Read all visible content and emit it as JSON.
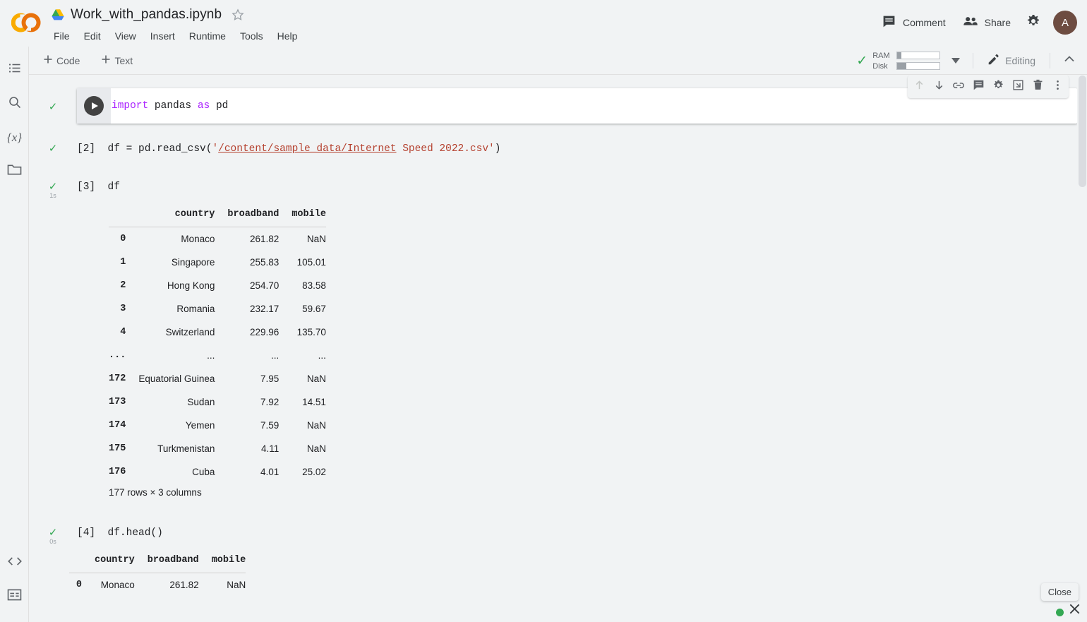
{
  "header": {
    "logo": "colab-logo",
    "drive_icon": "drive-icon",
    "doc_title": "Work_with_pandas.ipynb",
    "star_icon": "star-icon",
    "menu": [
      "File",
      "Edit",
      "View",
      "Insert",
      "Runtime",
      "Tools",
      "Help"
    ],
    "comment_label": "Comment",
    "comment_icon": "comment-icon",
    "share_label": "Share",
    "share_icon": "people-icon",
    "settings_icon": "gear-icon",
    "avatar_initial": "A",
    "avatar_color": "#6d4c41"
  },
  "toolbar": {
    "add_code": "Code",
    "add_text": "Text",
    "connected_check": "✓",
    "ram_label": "RAM",
    "disk_label": "Disk",
    "ram_fill_pct": 9,
    "disk_fill_pct": 21,
    "editing_label": "Editing",
    "editing_icon": "pencil-icon",
    "caret_icon": "chevron-down-icon",
    "collapse_icon": "chevron-up-icon"
  },
  "rail": {
    "items": [
      {
        "name": "toc-icon"
      },
      {
        "name": "search-icon"
      },
      {
        "name": "variables-icon",
        "glyph": "{x}"
      },
      {
        "name": "files-icon"
      }
    ],
    "bottom_items": [
      {
        "name": "code-snippets-icon",
        "glyph": "<>"
      },
      {
        "name": "terminal-icon"
      }
    ]
  },
  "cells": [
    {
      "id": "cell-1",
      "exec": "",
      "status_check": "✓",
      "duration": "",
      "code_parts": [
        {
          "t": "import",
          "c": "kw"
        },
        {
          "t": " pandas ",
          "c": ""
        },
        {
          "t": "as",
          "c": "kw"
        },
        {
          "t": " pd",
          "c": ""
        }
      ]
    },
    {
      "id": "cell-2",
      "exec": "[2]",
      "status_check": "✓",
      "duration": "",
      "code_parts": [
        {
          "t": "df = pd.read_csv(",
          "c": ""
        },
        {
          "t": "'",
          "c": "str"
        },
        {
          "t": "/content/sample_data/Internet",
          "c": "str-link"
        },
        {
          "t": " Speed 2022.csv'",
          "c": "str"
        },
        {
          "t": ")",
          "c": ""
        }
      ]
    },
    {
      "id": "cell-3",
      "exec": "[3]",
      "status_check": "✓",
      "duration": "1s",
      "code_parts": [
        {
          "t": "df",
          "c": ""
        }
      ]
    },
    {
      "id": "cell-4",
      "exec": "[4]",
      "status_check": "✓",
      "duration": "0s",
      "code_parts": [
        {
          "t": "df.head()",
          "c": ""
        }
      ]
    }
  ],
  "cell_toolbar": {
    "buttons": [
      {
        "name": "move-cell-up-icon",
        "disabled": true
      },
      {
        "name": "move-cell-down-icon",
        "disabled": false
      },
      {
        "name": "link-to-cell-icon",
        "disabled": false
      },
      {
        "name": "add-comment-icon",
        "disabled": false
      },
      {
        "name": "cell-settings-icon",
        "disabled": false
      },
      {
        "name": "mirror-cell-icon",
        "disabled": false
      },
      {
        "name": "delete-cell-icon",
        "disabled": false
      },
      {
        "name": "more-cell-actions-icon",
        "disabled": false
      }
    ]
  },
  "dataframe_full": {
    "columns": [
      "country",
      "broadband",
      "mobile"
    ],
    "rows": [
      {
        "index": "0",
        "country": "Monaco",
        "broadband": "261.82",
        "mobile": "NaN"
      },
      {
        "index": "1",
        "country": "Singapore",
        "broadband": "255.83",
        "mobile": "105.01"
      },
      {
        "index": "2",
        "country": "Hong Kong",
        "broadband": "254.70",
        "mobile": "83.58"
      },
      {
        "index": "3",
        "country": "Romania",
        "broadband": "232.17",
        "mobile": "59.67"
      },
      {
        "index": "4",
        "country": "Switzerland",
        "broadband": "229.96",
        "mobile": "135.70"
      },
      {
        "index": "...",
        "country": "...",
        "broadband": "...",
        "mobile": "..."
      },
      {
        "index": "172",
        "country": "Equatorial Guinea",
        "broadband": "7.95",
        "mobile": "NaN"
      },
      {
        "index": "173",
        "country": "Sudan",
        "broadband": "7.92",
        "mobile": "14.51"
      },
      {
        "index": "174",
        "country": "Yemen",
        "broadband": "7.59",
        "mobile": "NaN"
      },
      {
        "index": "175",
        "country": "Turkmenistan",
        "broadband": "4.11",
        "mobile": "NaN"
      },
      {
        "index": "176",
        "country": "Cuba",
        "broadband": "4.01",
        "mobile": "25.02"
      }
    ],
    "shape": "177 rows × 3 columns"
  },
  "dataframe_head": {
    "columns": [
      "country",
      "broadband",
      "mobile"
    ],
    "rows": [
      {
        "index": "0",
        "country": "Monaco",
        "broadband": "261.82",
        "mobile": "NaN"
      }
    ]
  },
  "footer": {
    "close_tooltip": "Close",
    "status_dot_color": "#34a853",
    "close_icon": "close-icon"
  }
}
